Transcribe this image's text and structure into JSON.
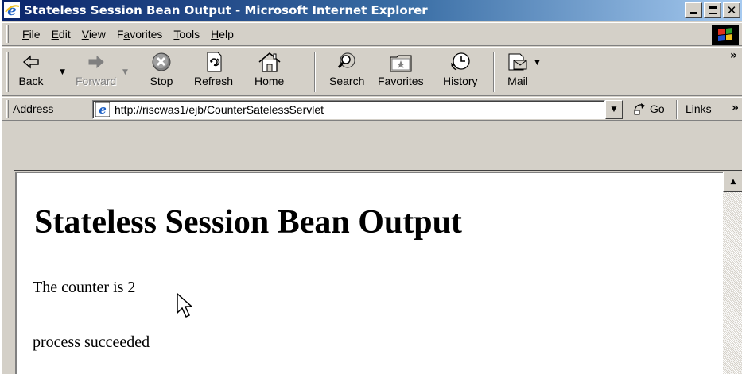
{
  "window": {
    "title": "Stateless Session Bean Output - Microsoft Internet Explorer"
  },
  "menu": [
    {
      "label": "File",
      "accel": "F",
      "rest": "ile"
    },
    {
      "label": "Edit",
      "accel": "E",
      "rest": "dit"
    },
    {
      "label": "View",
      "accel": "V",
      "rest": "iew"
    },
    {
      "label": "Favorites",
      "pre": "F",
      "accel": "a",
      "rest": "vorites"
    },
    {
      "label": "Tools",
      "accel": "T",
      "rest": "ools"
    },
    {
      "label": "Help",
      "accel": "H",
      "rest": "elp"
    }
  ],
  "toolbar": {
    "back": "Back",
    "forward": "Forward",
    "stop": "Stop",
    "refresh": "Refresh",
    "home": "Home",
    "search": "Search",
    "favorites": "Favorites",
    "history": "History",
    "mail": "Mail"
  },
  "address": {
    "label_pre": "A",
    "label_accel": "d",
    "label_rest": "dress",
    "url": "http://riscwas1/ejb/CounterSatelessServlet",
    "go": "Go",
    "links": "Links"
  },
  "page": {
    "heading": "Stateless Session Bean Output",
    "counter_text": "The counter is 2",
    "status_text": "process succeeded"
  },
  "colors": {
    "title_bar_start": "#0a246a",
    "title_bar_end": "#a6caf0",
    "chrome": "#d4d0c8"
  }
}
